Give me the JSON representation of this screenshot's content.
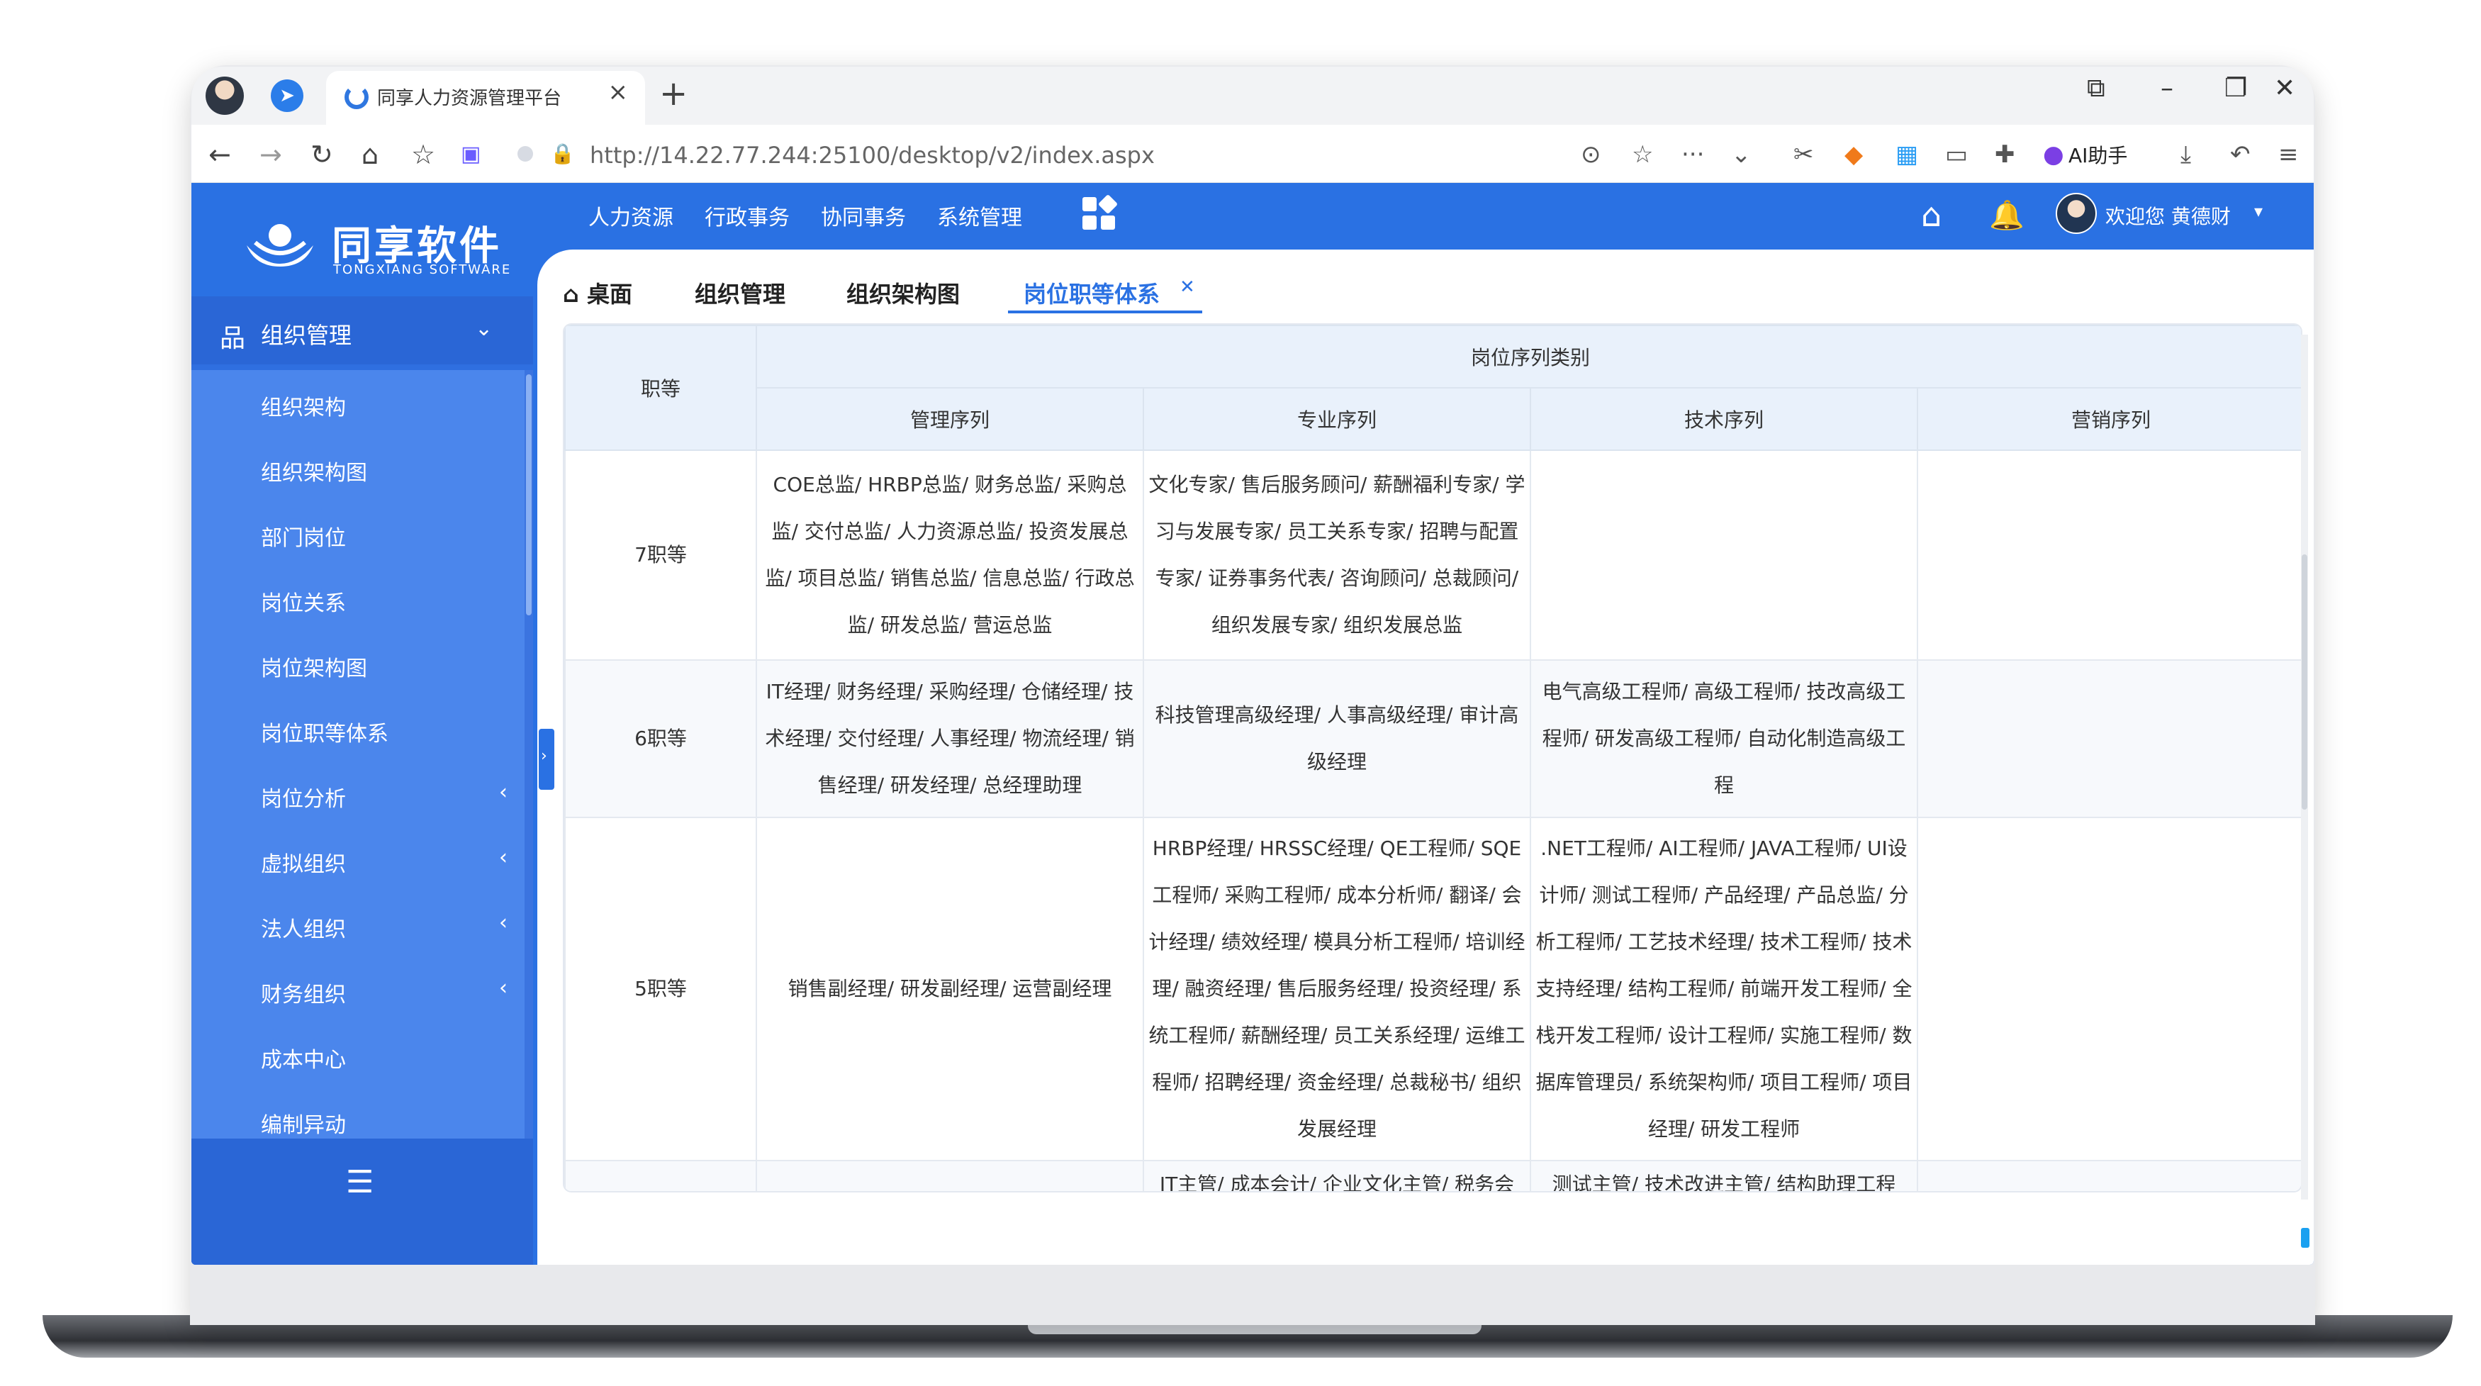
{
  "browser": {
    "tab_title": "同享人力资源管理平台",
    "url": "http://14.22.77.244:25100/desktop/v2/index.aspx",
    "ai_label": "AI助手"
  },
  "header": {
    "logo_title": "同享软件",
    "logo_sub": "TONGXIANG SOFTWARE",
    "menu": [
      "人力资源",
      "行政事务",
      "协同事务",
      "系统管理"
    ],
    "user_greeting": "欢迎您 黄德财"
  },
  "sidebar": {
    "group_label": "组织管理",
    "items": [
      {
        "label": "组织架构",
        "expandable": false
      },
      {
        "label": "组织架构图",
        "expandable": false
      },
      {
        "label": "部门岗位",
        "expandable": false
      },
      {
        "label": "岗位关系",
        "expandable": false
      },
      {
        "label": "岗位架构图",
        "expandable": false
      },
      {
        "label": "岗位职等体系",
        "expandable": false
      },
      {
        "label": "岗位分析",
        "expandable": true
      },
      {
        "label": "虚拟组织",
        "expandable": true
      },
      {
        "label": "法人组织",
        "expandable": true
      },
      {
        "label": "财务组织",
        "expandable": true
      },
      {
        "label": "成本中心",
        "expandable": false
      },
      {
        "label": "编制异动",
        "expandable": false
      }
    ]
  },
  "page_tabs": [
    {
      "label": "桌面",
      "active": false
    },
    {
      "label": "组织管理",
      "active": false
    },
    {
      "label": "组织架构图",
      "active": false
    },
    {
      "label": "岗位职等体系",
      "active": true
    }
  ],
  "table": {
    "grade_header": "职等",
    "group_header": "岗位序列类别",
    "columns": [
      "管理序列",
      "专业序列",
      "技术序列",
      "营销序列"
    ],
    "rows": [
      {
        "grade": "7职等",
        "cells": [
          "COE总监/ HRBP总监/ 财务总监/ 采购总监/ 交付总监/ 人力资源总监/ 投资发展总监/ 项目总监/ 销售总监/ 信息总监/ 行政总监/ 研发总监/ 营运总监",
          "文化专家/ 售后服务顾问/ 薪酬福利专家/ 学习与发展专家/ 员工关系专家/ 招聘与配置专家/ 证券事务代表/ 咨询顾问/ 总裁顾问/ 组织发展专家/ 组织发展总监",
          "",
          ""
        ]
      },
      {
        "grade": "6职等",
        "cells": [
          "IT经理/ 财务经理/ 采购经理/ 仓储经理/ 技术经理/ 交付经理/ 人事经理/ 物流经理/ 销售经理/ 研发经理/ 总经理助理",
          "科技管理高级经理/ 人事高级经理/ 审计高级经理",
          "电气高级工程师/ 高级工程师/ 技改高级工程师/ 研发高级工程师/ 自动化制造高级工程",
          ""
        ]
      },
      {
        "grade": "5职等",
        "cells": [
          "销售副经理/ 研发副经理/ 运营副经理",
          "HRBP经理/ HRSSC经理/ QE工程师/ SQE工程师/ 采购工程师/ 成本分析师/ 翻译/ 会计经理/ 绩效经理/ 模具分析工程师/ 培训经理/ 融资经理/ 售后服务经理/ 投资经理/ 系统工程师/ 薪酬经理/ 员工关系经理/ 运维工程师/ 招聘经理/ 资金经理/ 总裁秘书/ 组织发展经理",
          ".NET工程师/ AI工程师/ JAVA工程师/ UI设计师/ 测试工程师/ 产品经理/ 产品总监/ 分析工程师/ 工艺技术经理/ 技术工程师/ 技术支持经理/ 结构工程师/ 前端开发工程师/ 全栈开发工程师/ 设计工程师/ 实施工程师/ 数据库管理员/ 系统架构师/ 项目工程师/ 项目经理/ 研发工程师",
          ""
        ]
      },
      {
        "grade": "",
        "cells": [
          "",
          "IT主管/ 成本会计/ 企业文化主管/ 税务会",
          "测试主管/ 技术改进主管/ 结构助理工程",
          ""
        ]
      }
    ]
  }
}
